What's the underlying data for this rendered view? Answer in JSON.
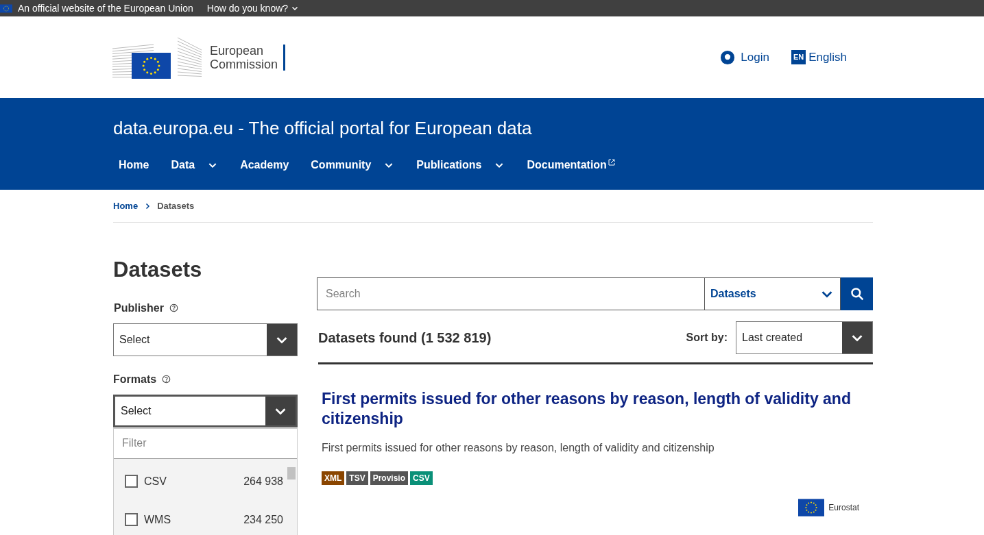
{
  "top_bar": {
    "text": "An official website of the European Union",
    "link": "How do you know?"
  },
  "header": {
    "logo_line_1": "European",
    "logo_line_2": "Commission",
    "login": "Login",
    "language_code": "EN",
    "language": "English"
  },
  "site": {
    "title": "data.europa.eu - The official portal for European data"
  },
  "nav": [
    {
      "label": "Home",
      "kind": "plain"
    },
    {
      "label": "Data",
      "kind": "dropdown"
    },
    {
      "label": "Academy",
      "kind": "plain"
    },
    {
      "label": "Community",
      "kind": "dropdown"
    },
    {
      "label": "Publications",
      "kind": "dropdown"
    },
    {
      "label": "Documentation",
      "kind": "external"
    }
  ],
  "breadcrumb": [
    {
      "label": "Home",
      "selected": false
    },
    {
      "label": "Datasets",
      "selected": true
    }
  ],
  "page_title": "Datasets",
  "filters": {
    "publisher": {
      "label": "Publisher",
      "value": "Select"
    },
    "formats": {
      "label": "Formats",
      "value": "Select",
      "expanded": true,
      "filter_placeholder": "Filter",
      "options": [
        {
          "label": "CSV",
          "count": "264 938",
          "checked": false
        },
        {
          "label": "WMS",
          "count": "234 250",
          "checked": false
        }
      ]
    }
  },
  "search": {
    "placeholder": "Search",
    "scope": "Datasets"
  },
  "results": {
    "count_text": "Datasets found (1 532 819)",
    "sort_label": "Sort by:",
    "sort_value": "Last created"
  },
  "datasets": [
    {
      "title": "First permits issued for other reasons by reason, length of validity and citizenship",
      "description": "First permits issued for other reasons by reason, length of validity and citizenship",
      "formats": [
        {
          "label": "XML",
          "color": "#8a4500"
        },
        {
          "label": "TSV",
          "color": "#555555"
        },
        {
          "label": "Provisio",
          "color": "#555555"
        },
        {
          "label": "CSV",
          "color": "#0a9078"
        }
      ],
      "publisher": "Eurostat"
    }
  ]
}
